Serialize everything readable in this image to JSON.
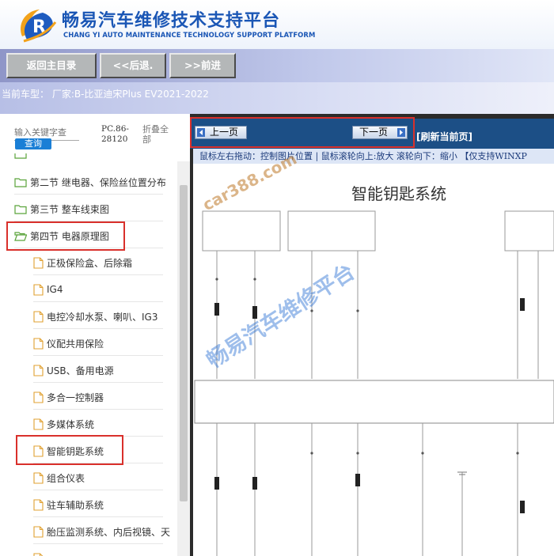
{
  "header": {
    "title": "畅易汽车维修技术支持平台",
    "subtitle": "CHANG YI AUTO MAINTENANCE TECHNOLOGY SUPPORT PLATFORM",
    "logo_icon": "cr-logo-icon",
    "brand_color": "#1a56b5"
  },
  "nav": {
    "home_label": "返回主目录",
    "back_label": "<<后退.",
    "forward_label": ">>前进"
  },
  "model_line": "当前车型： 厂家:B-比亚迪宋Plus EV2021-2022",
  "sidebar": {
    "search_placeholder": "输入关键字查",
    "query_label": "查询",
    "pc_code": "PC.86-28120",
    "collapse_label": "折叠全部",
    "items": [
      {
        "label": "第二节 继电器、保险丝位置分布",
        "level": 1,
        "icon": "folder-icon"
      },
      {
        "label": "第三节 整车线束图",
        "level": 1,
        "icon": "folder-icon"
      },
      {
        "label": "第四节 电器原理图",
        "level": 1,
        "icon": "folder-open-icon"
      },
      {
        "label": "正极保险盒、后除霜",
        "level": 2,
        "icon": "document-icon"
      },
      {
        "label": "IG4",
        "level": 2,
        "icon": "document-icon"
      },
      {
        "label": "电控冷却水泵、喇叭、IG3",
        "level": 2,
        "icon": "document-icon"
      },
      {
        "label": "仪配共用保险",
        "level": 2,
        "icon": "document-icon"
      },
      {
        "label": "USB、备用电源",
        "level": 2,
        "icon": "document-icon"
      },
      {
        "label": "多合一控制器",
        "level": 2,
        "icon": "document-icon"
      },
      {
        "label": "多媒体系统",
        "level": 2,
        "icon": "document-icon"
      },
      {
        "label": "智能钥匙系统",
        "level": 2,
        "icon": "document-icon"
      },
      {
        "label": "组合仪表",
        "level": 2,
        "icon": "document-icon"
      },
      {
        "label": "驻车辅助系统",
        "level": 2,
        "icon": "document-icon"
      },
      {
        "label": "胎压监测系统、内后视镜、天",
        "level": 2,
        "icon": "document-icon"
      }
    ]
  },
  "viewer": {
    "prev_label": "上一页",
    "next_label": "下一页",
    "refresh_label": "[刷新当前页]",
    "hint": "鼠标左右拖动：控制图片位置 | 鼠标滚轮向上:放大  滚轮向下：缩小 【仅支持WINXP",
    "diagram_title": "智能钥匙系统",
    "watermark_site": "car388.com",
    "watermark_brand": "畅易汽车维修平台",
    "highlight_color": "#d9302b"
  }
}
